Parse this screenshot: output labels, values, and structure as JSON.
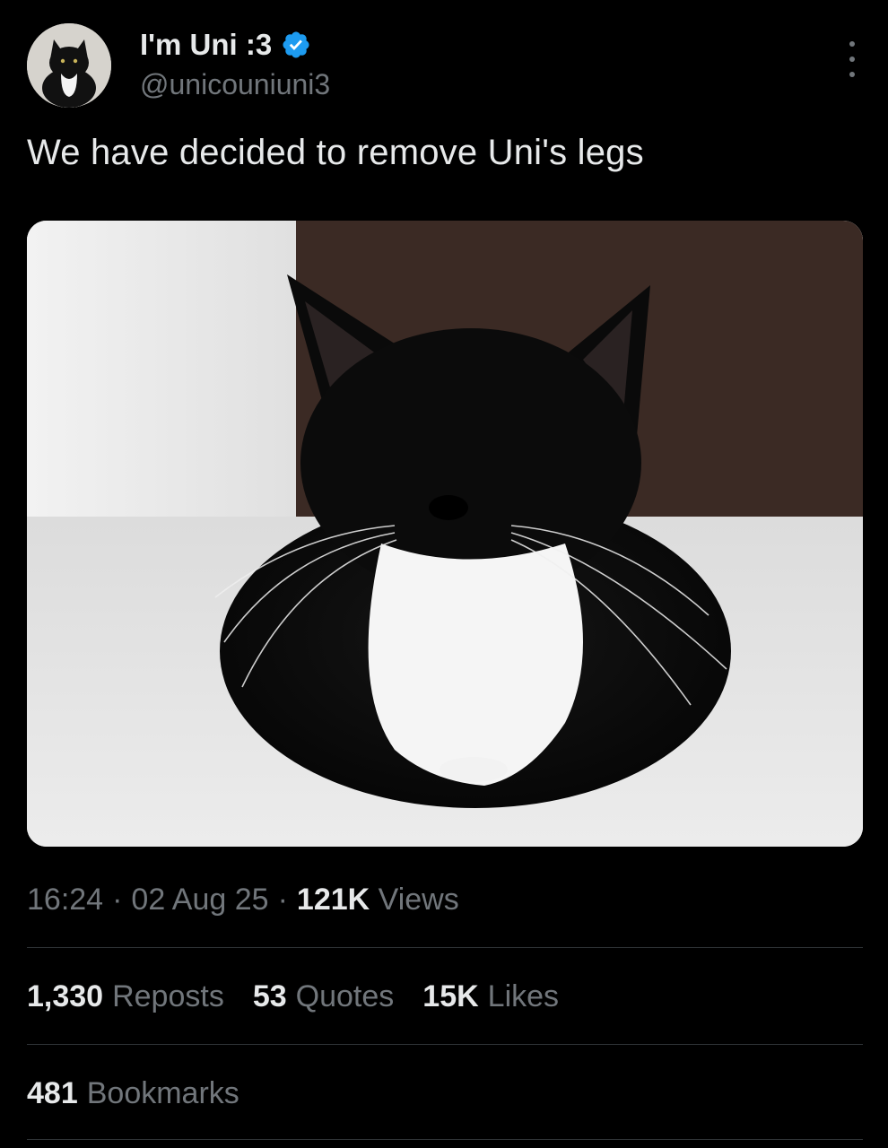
{
  "author": {
    "display_name": "I'm Uni :3",
    "handle": "@unicouniuni3",
    "verified": true,
    "avatar_icon": "cat-avatar"
  },
  "tweet": {
    "text": "We have decided to remove Uni's legs",
    "image_alt": "black-and-white tuxedo cat loafing on a floor with eyes closed"
  },
  "meta": {
    "time": "16:24",
    "date": "02 Aug 25",
    "separator": "·",
    "views_count": "121K",
    "views_label": "Views"
  },
  "stats": {
    "reposts_count": "1,330",
    "reposts_label": "Reposts",
    "quotes_count": "53",
    "quotes_label": "Quotes",
    "likes_count": "15K",
    "likes_label": "Likes",
    "bookmarks_count": "481",
    "bookmarks_label": "Bookmarks"
  },
  "colors": {
    "background": "#000000",
    "primary_text": "#e7e9ea",
    "secondary_text": "#71767b",
    "verified_badge": "#1d9bf0",
    "divider": "#2f3336"
  },
  "icons": [
    "verified-badge-icon",
    "more-options-icon"
  ]
}
